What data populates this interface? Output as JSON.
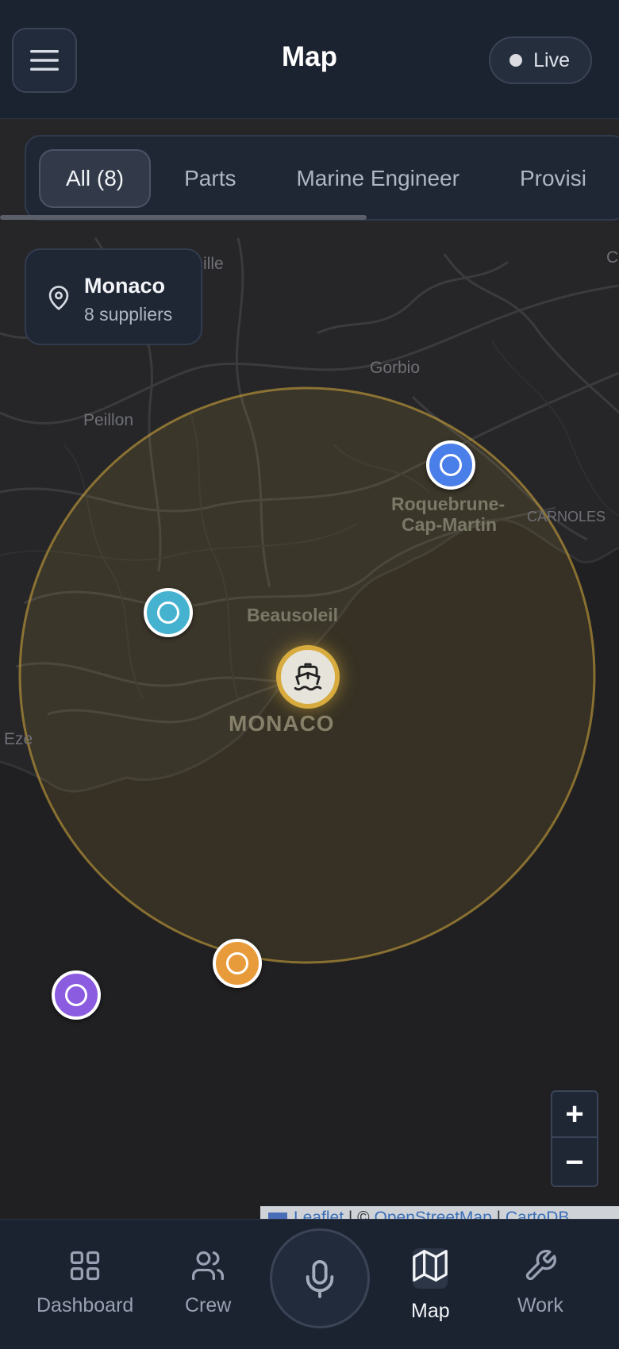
{
  "header": {
    "title": "Map",
    "live_label": "Live"
  },
  "filters": {
    "items": [
      "All (8)",
      "Parts",
      "Marine Engineer",
      "Provisi"
    ],
    "active_index": 0
  },
  "location": {
    "name": "Monaco",
    "subtitle": "8 suppliers"
  },
  "map": {
    "labels": {
      "gorbio": "Gorbio",
      "peillon": "Peillon",
      "roquebrune_line1": "Roquebrune-",
      "roquebrune_line2": "Cap-Martin",
      "carnoles": "CARNOLES",
      "beausoleil": "Beausoleil",
      "monaco": "MONACO",
      "eze": "Eze",
      "ille": "ille",
      "edge_c": "C"
    },
    "markers": [
      {
        "name": "supplier-marker-blue",
        "color": "#4a7ee8"
      },
      {
        "name": "supplier-marker-teal",
        "color": "#45b2d0"
      },
      {
        "name": "supplier-marker-orange",
        "color": "#e89b3a"
      },
      {
        "name": "supplier-marker-purple",
        "color": "#8b5be0"
      }
    ],
    "radius_color": "#d7ab3d",
    "zoom": {
      "in_label": "+",
      "out_label": "−"
    },
    "attribution": {
      "leaflet": "Leaflet",
      "sep1": " | © ",
      "osm": "OpenStreetMap",
      "sep2": " | ",
      "carto": "CartoDB"
    }
  },
  "bottom_nav": {
    "items": [
      {
        "label": "Dashboard",
        "icon": "grid-icon"
      },
      {
        "label": "Crew",
        "icon": "users-icon"
      },
      {
        "label": "Map",
        "icon": "map-icon"
      },
      {
        "label": "Work",
        "icon": "wrench-icon"
      }
    ],
    "active": "Map",
    "mic_icon": "microphone-icon"
  }
}
